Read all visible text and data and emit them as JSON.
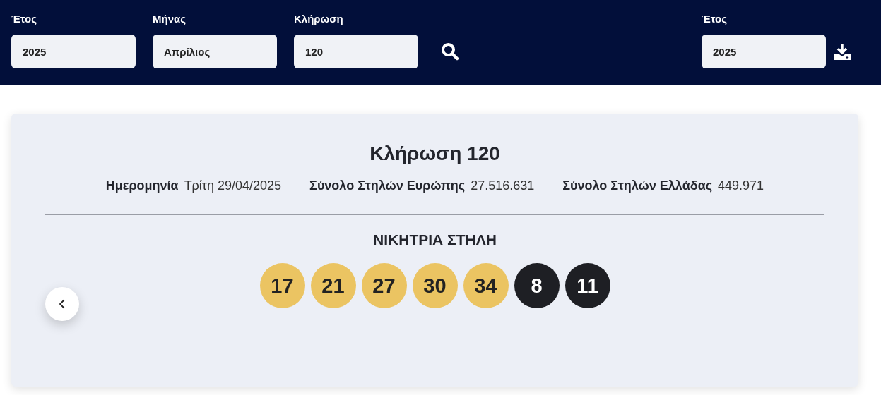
{
  "filters": [
    {
      "label": "Έτος",
      "value": "2025"
    },
    {
      "label": "Μήνας",
      "value": "Απρίλιος"
    },
    {
      "label": "Κλήρωση",
      "value": "120"
    }
  ],
  "export": {
    "label": "Έτος",
    "value": "2025"
  },
  "draw": {
    "title": "Κλήρωση 120",
    "info": [
      {
        "label": "Ημερομηνία",
        "value": "Τρίτη 29/04/2025"
      },
      {
        "label": "Σύνολο Στηλών Ευρώπης",
        "value": "27.516.631"
      },
      {
        "label": "Σύνολο Στηλών Ελλάδας",
        "value": "449.971"
      }
    ],
    "winning_heading": "ΝΙΚΗΤΡΙΑ ΣΤΗΛΗ",
    "balls": [
      {
        "number": "17",
        "kind": "main"
      },
      {
        "number": "21",
        "kind": "main"
      },
      {
        "number": "27",
        "kind": "main"
      },
      {
        "number": "30",
        "kind": "main"
      },
      {
        "number": "34",
        "kind": "main"
      },
      {
        "number": "8",
        "kind": "bonus"
      },
      {
        "number": "11",
        "kind": "bonus"
      }
    ]
  }
}
